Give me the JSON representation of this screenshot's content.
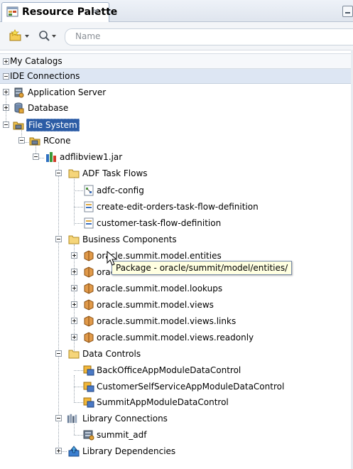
{
  "panel": {
    "title": "Resource Palette",
    "close_glyph": "×",
    "search_placeholder": "Name"
  },
  "sections": {
    "my_catalogs": "My Catalogs",
    "ide_connections": "IDE Connections"
  },
  "tree": {
    "application_server": "Application Server",
    "database": "Database",
    "file_system": "File System",
    "rcone": "RCone",
    "jar": "adflibview1.jar",
    "adf_task_flows": "ADF Task Flows",
    "task_flows": [
      "adfc-config",
      "create-edit-orders-task-flow-definition",
      "customer-task-flow-definition"
    ],
    "business_components": "Business Components",
    "packages": [
      "oracle.summit.model.entities",
      "oracle.summit.model.entities.assoc",
      "oracle.summit.model.lookups",
      "oracle.summit.model.views",
      "oracle.summit.model.views.links",
      "oracle.summit.model.views.readonly"
    ],
    "data_controls": "Data Controls",
    "data_control_items": [
      "BackOfficeAppModuleDataControl",
      "CustomerSelfServiceAppModuleDataControl",
      "SummitAppModuleDataControl"
    ],
    "library_connections": "Library Connections",
    "summit_adf": "summit_adf",
    "library_dependencies": "Library Dependencies"
  },
  "tooltip": "Package - oracle/summit/model/entities/",
  "icons": {
    "palette": "resource-palette-icon",
    "new": "new-catalog-icon",
    "search": "search-icon",
    "server": "application-server-icon",
    "database": "database-icon",
    "filesystem": "file-system-icon",
    "jar": "jar-icon",
    "folder": "folder-icon",
    "taskflow": "task-flow-icon",
    "package": "package-icon",
    "datacontrol": "data-control-icon",
    "library": "library-icon",
    "dependency": "dependency-icon"
  },
  "colors": {
    "selection": "#2c5ca5",
    "tooltip_bg": "#ffffe1",
    "section_bg": "#dde6f3"
  }
}
